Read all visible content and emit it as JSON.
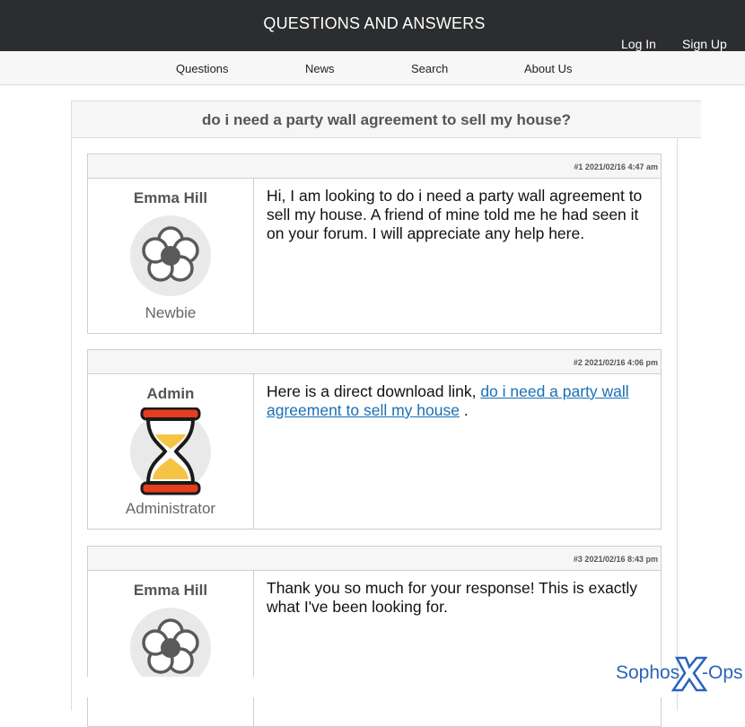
{
  "header": {
    "site_title": "QUESTIONS AND ANSWERS",
    "login_label": "Log In",
    "signup_label": "Sign Up"
  },
  "nav": {
    "items": [
      "Questions",
      "News",
      "Search",
      "About Us"
    ]
  },
  "thread": {
    "title": "do i need a party wall agreement to sell my house?"
  },
  "posts": [
    {
      "meta": "#1 2021/02/16 4:47 am",
      "author": "Emma Hill",
      "role": "Newbie",
      "avatar_icon": "flower-icon",
      "text": "Hi, I am looking to do i need a party wall agreement to sell my house. A friend of mine told me he had seen it on your forum. I will appreciate any help here."
    },
    {
      "meta": "#2 2021/02/16 4:06 pm",
      "author": "Admin",
      "role": "Administrator",
      "avatar_icon": "hourglass-icon",
      "text_before": "Here is a direct download link, ",
      "link_text": "do i need a party wall agreement to sell my house",
      "text_after": " ."
    },
    {
      "meta": "#3 2021/02/16 8:43 pm",
      "author": "Emma Hill",
      "role": "",
      "avatar_icon": "flower-icon",
      "text": "Thank you so much for your response! This is exactly what I've been looking for."
    }
  ],
  "watermark": {
    "brand": "Sophos",
    "suffix": "Ops"
  },
  "colors": {
    "topbar": "#2b2d2f",
    "link": "#1a6fb5",
    "watermark": "#2a64b8"
  }
}
